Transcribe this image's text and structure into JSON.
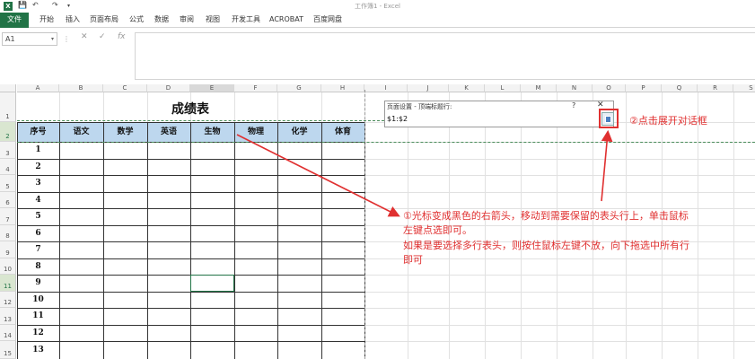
{
  "window": {
    "title": "工作簿1 - Excel",
    "app_letter": "X"
  },
  "quick_access": {
    "save": "💾",
    "undo": "↶",
    "redo": "↷",
    "more": "▾"
  },
  "ribbon_tabs": [
    "文件",
    "开始",
    "插入",
    "页面布局",
    "公式",
    "数据",
    "审阅",
    "视图",
    "开发工具",
    "ACROBAT",
    "百度网盘"
  ],
  "formula_bar": {
    "name_box": "A1",
    "dropdown": "▾",
    "dots": "⋮",
    "cancel": "✕",
    "enter": "✓",
    "fx": "fx",
    "formula": ""
  },
  "columns": [
    "A",
    "B",
    "C",
    "D",
    "E",
    "F",
    "G",
    "H",
    "I",
    "J",
    "K",
    "L",
    "M",
    "N",
    "O",
    "P",
    "Q",
    "R",
    "S"
  ],
  "rows": [
    "1",
    "2",
    "3",
    "4",
    "5",
    "6",
    "7",
    "8",
    "9",
    "10",
    "11",
    "12",
    "13",
    "14",
    "15"
  ],
  "sheet_table": {
    "title": "成绩表",
    "headers": [
      "序号",
      "语文",
      "数学",
      "英语",
      "生物",
      "物理",
      "化学",
      "体育"
    ],
    "serials": [
      "1",
      "2",
      "3",
      "4",
      "5",
      "6",
      "7",
      "8",
      "9",
      "10",
      "11",
      "12",
      "13"
    ]
  },
  "dialog": {
    "title": "页面设置 - 顶端标题行:",
    "help": "?",
    "close": "✕",
    "value": "$1:$2"
  },
  "annotations": {
    "step2": "②点击展开对话框",
    "step1_line1": "①光标变成黑色的右箭头，移动到需要保留的表头行上，单击鼠标",
    "step1_line2": "左键点选即可。",
    "step1_line3": "如果是要选择多行表头，则按住鼠标左键不放，向下拖选中所有行",
    "step1_line4": "即可"
  },
  "colors": {
    "excel_green": "#217346",
    "header_fill": "#bdd7ee",
    "annotation_red": "#e03030"
  }
}
